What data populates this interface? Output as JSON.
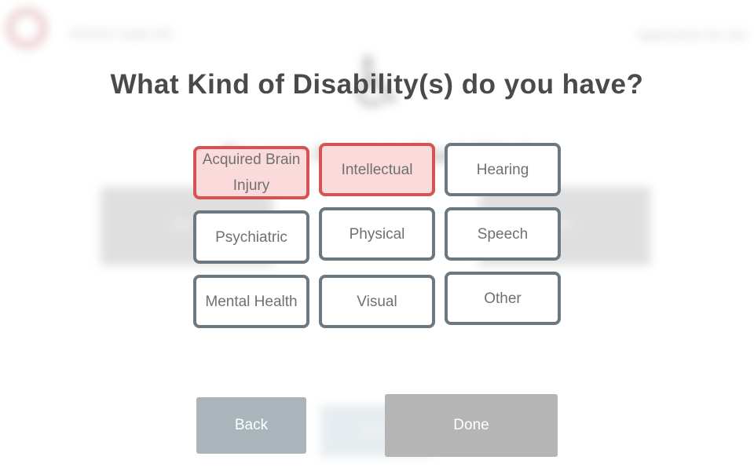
{
  "background": {
    "brand": "Victoria Legal Aid",
    "app_label": "Application for Aid",
    "wheelchair_glyph": "♿",
    "question": "Do you have a disability?",
    "left_option": "Yes",
    "right_option": "No",
    "bottom_button": "Next"
  },
  "dialog": {
    "title": "What Kind of Disability(s) do you have?",
    "options": [
      {
        "label": "Acquired Brain Injury",
        "selected": true
      },
      {
        "label": "Intellectual",
        "selected": true
      },
      {
        "label": "Hearing",
        "selected": false
      },
      {
        "label": "Psychiatric",
        "selected": false
      },
      {
        "label": "Physical",
        "selected": false
      },
      {
        "label": "Speech",
        "selected": false
      },
      {
        "label": "Mental Health",
        "selected": false
      },
      {
        "label": "Visual",
        "selected": false
      },
      {
        "label": "Other",
        "selected": false
      }
    ],
    "back_label": "Back",
    "done_label": "Done"
  },
  "colors": {
    "selected_fill": "#fadada",
    "selected_border": "#d45454",
    "unselected_border": "#6a7880",
    "back_button": "#a9b4bb",
    "done_button": "#b5b5b5"
  }
}
